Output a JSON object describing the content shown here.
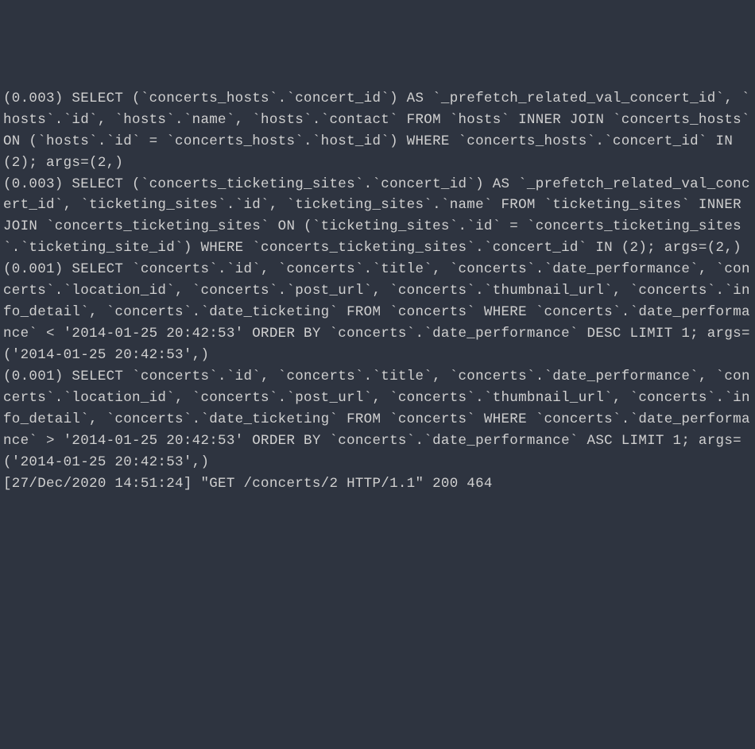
{
  "terminal": {
    "lines": [
      "(0.003) SELECT (`concerts_hosts`.`concert_id`) AS `_prefetch_related_val_concert_id`, `hosts`.`id`, `hosts`.`name`, `hosts`.`contact` FROM `hosts` INNER JOIN `concerts_hosts` ON (`hosts`.`id` = `concerts_hosts`.`host_id`) WHERE `concerts_hosts`.`concert_id` IN (2); args=(2,)",
      "(0.003) SELECT (`concerts_ticketing_sites`.`concert_id`) AS `_prefetch_related_val_concert_id`, `ticketing_sites`.`id`, `ticketing_sites`.`name` FROM `ticketing_sites` INNER JOIN `concerts_ticketing_sites` ON (`ticketing_sites`.`id` = `concerts_ticketing_sites`.`ticketing_site_id`) WHERE `concerts_ticketing_sites`.`concert_id` IN (2); args=(2,)",
      "(0.001) SELECT `concerts`.`id`, `concerts`.`title`, `concerts`.`date_performance`, `concerts`.`location_id`, `concerts`.`post_url`, `concerts`.`thumbnail_url`, `concerts`.`info_detail`, `concerts`.`date_ticketing` FROM `concerts` WHERE `concerts`.`date_performance` < '2014-01-25 20:42:53' ORDER BY `concerts`.`date_performance` DESC LIMIT 1; args=('2014-01-25 20:42:53',)",
      "(0.001) SELECT `concerts`.`id`, `concerts`.`title`, `concerts`.`date_performance`, `concerts`.`location_id`, `concerts`.`post_url`, `concerts`.`thumbnail_url`, `concerts`.`info_detail`, `concerts`.`date_ticketing` FROM `concerts` WHERE `concerts`.`date_performance` > '2014-01-25 20:42:53' ORDER BY `concerts`.`date_performance` ASC LIMIT 1; args=('2014-01-25 20:42:53',)",
      "[27/Dec/2020 14:51:24] \"GET /concerts/2 HTTP/1.1\" 200 464"
    ]
  }
}
